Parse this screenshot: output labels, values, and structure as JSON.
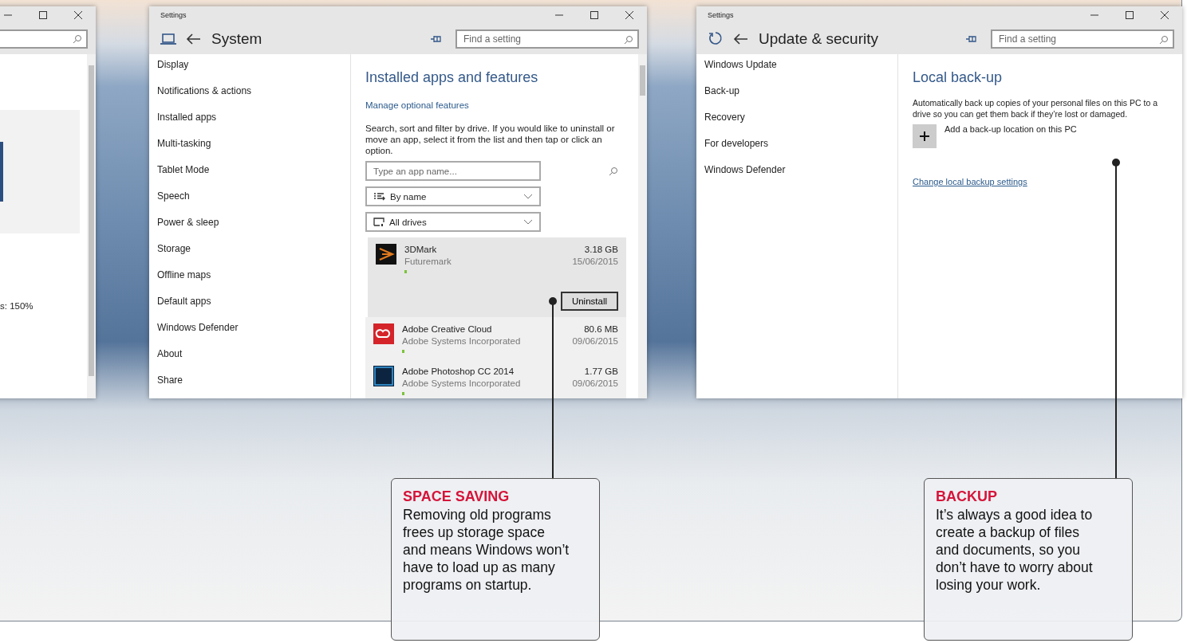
{
  "windows": [
    {
      "kind": "clipped",
      "text": "s: 150%"
    },
    {
      "kind": "system",
      "title": "Settings",
      "header": "System",
      "search": {
        "placeholder": "Find a setting"
      },
      "sidebar": {
        "items": [
          "Display",
          "Notifications & actions",
          "Installed apps",
          "Multi-tasking",
          "Tablet Mode",
          "Speech",
          "Power & sleep",
          "Storage",
          "Offline maps",
          "Default apps",
          "Windows Defender",
          "About",
          "Share"
        ]
      },
      "content": {
        "kind": "apps",
        "heading": "Installed apps and features",
        "link": "Manage optional features",
        "description": "Search, sort and filter by drive. If you would like to uninstall or move an app, select it from the list and then tap or click an option.",
        "app_search": {
          "placeholder": "Type an app name..."
        },
        "sort": {
          "value": "By name"
        },
        "filter": {
          "value": "All drives"
        },
        "uninstall_button": "Uninstall",
        "apps": [
          {
            "kind": "chevron",
            "name": "3DMark",
            "publisher": "Futuremark",
            "size": "3.18 GB",
            "date": "15/06/2015",
            "selected": true
          },
          {
            "kind": "swirl",
            "name": "Adobe Creative Cloud",
            "publisher": "Adobe Systems Incorporated",
            "size": "80.6 MB",
            "date": "09/06/2015",
            "selected": false
          },
          {
            "kind": "square",
            "name": "Adobe Photoshop CC 2014",
            "publisher": "Adobe Systems Incorporated",
            "size": "1.77 GB",
            "date": "09/06/2015",
            "selected": false
          }
        ]
      }
    },
    {
      "kind": "update",
      "title": "Settings",
      "header": "Update & security",
      "search": {
        "placeholder": "Find a setting"
      },
      "sidebar": {
        "items": [
          "Windows Update",
          "Back-up",
          "Recovery",
          "For developers",
          "Windows Defender"
        ]
      },
      "content": {
        "kind": "backup",
        "heading": "Local back-up",
        "description": "Automatically back up copies of your personal files on this PC to a drive so you can get them back if they’re lost or damaged.",
        "add_button": "Add a back-up location on this PC",
        "link": "Change local backup settings"
      }
    }
  ],
  "callouts": [
    {
      "title": "SPACE SAVING",
      "text": "Removing old programs frees up storage space and means Windows won’t have to load up as many programs on startup."
    },
    {
      "title": "BACKUP",
      "text": "It’s always a good idea to create a backup of files and documents, so you don’t have to worry about losing your work."
    }
  ]
}
